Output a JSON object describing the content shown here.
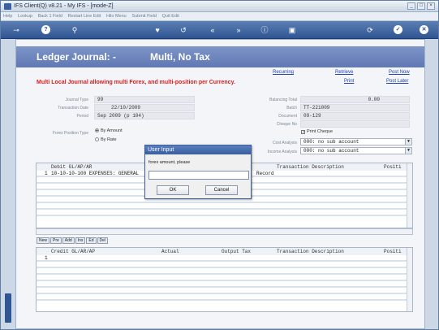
{
  "window": {
    "title": "IFS Client(Q) v8.21 - My IFS -     [mode-Z]",
    "controls": [
      "_",
      "□",
      "×"
    ]
  },
  "menu": [
    "Help",
    "Lookup",
    "Back 1 Field",
    "Restart Line Edit",
    "Hilo Menu",
    "Submit Field",
    "Quit Edit"
  ],
  "toolbar_icons": [
    "key-icon",
    "help-icon",
    "search-icon",
    "heart-icon",
    "undo-icon",
    "rewind-icon",
    "fast-forward-icon",
    "info-icon",
    "save-icon",
    "refresh-icon",
    "accept-icon",
    "cancel-icon"
  ],
  "header": {
    "title_left": "Ledger Journal: -",
    "title_right": "Multi, No Tax"
  },
  "actions": {
    "recurring": "Recurring",
    "retrieve": "Retrieve",
    "post_now": "Post Now",
    "print": "Print",
    "post_later": "Post Later"
  },
  "banner": "Multi Local Journal allowing multi Forex, and multi-position per Currency.",
  "left_fields": {
    "journal_type": {
      "label": "Journal Type",
      "value": "99"
    },
    "transaction_date": {
      "label": "Transaction Date",
      "value": "22/10/2009"
    },
    "period": {
      "label": "Period",
      "value": "Sep 2009 (p 104)"
    },
    "forex_position_type": {
      "label": "Forex Position Type"
    },
    "by_amount": "By Amount",
    "by_rate": "By Rate"
  },
  "right_fields": {
    "balancing_total": {
      "label": "Balancing Total",
      "value": "0.00"
    },
    "batch": {
      "label": "Batch",
      "value": "TT-221009"
    },
    "document": {
      "label": "Document",
      "value": "09-129"
    },
    "cheque_no": {
      "label": "Cheque No",
      "value": ""
    },
    "print_cheque": "Print Cheque",
    "cost_analysis": {
      "label": "Cost Analysis",
      "value": "000: no sub account"
    },
    "income_analysis": {
      "label": "Income Analysis",
      "value": "000: no sub account"
    }
  },
  "debit_grid": {
    "headers": {
      "account": "Debit GL/AP/AR",
      "description": "Transaction Description",
      "position": "Positi"
    },
    "rows": [
      {
        "num": "1",
        "account": "10-10-10-100 EXPENSES: GENERAL",
        "description": "Record"
      }
    ]
  },
  "mini_tabs": [
    "New",
    "Pre",
    "Add",
    "Ins",
    "Ed",
    "Del"
  ],
  "credit_grid": {
    "headers": {
      "account": "Credit GL/AR/AP",
      "actual": "Actual",
      "output_tax": "Output Tax",
      "description": "Transaction Description",
      "position": "Positi"
    },
    "rows": [
      {
        "num": "1"
      }
    ]
  },
  "dialog": {
    "title": "User Input",
    "prompt": "forex amount, please",
    "value": "",
    "ok": "OK",
    "cancel": "Cancel"
  }
}
